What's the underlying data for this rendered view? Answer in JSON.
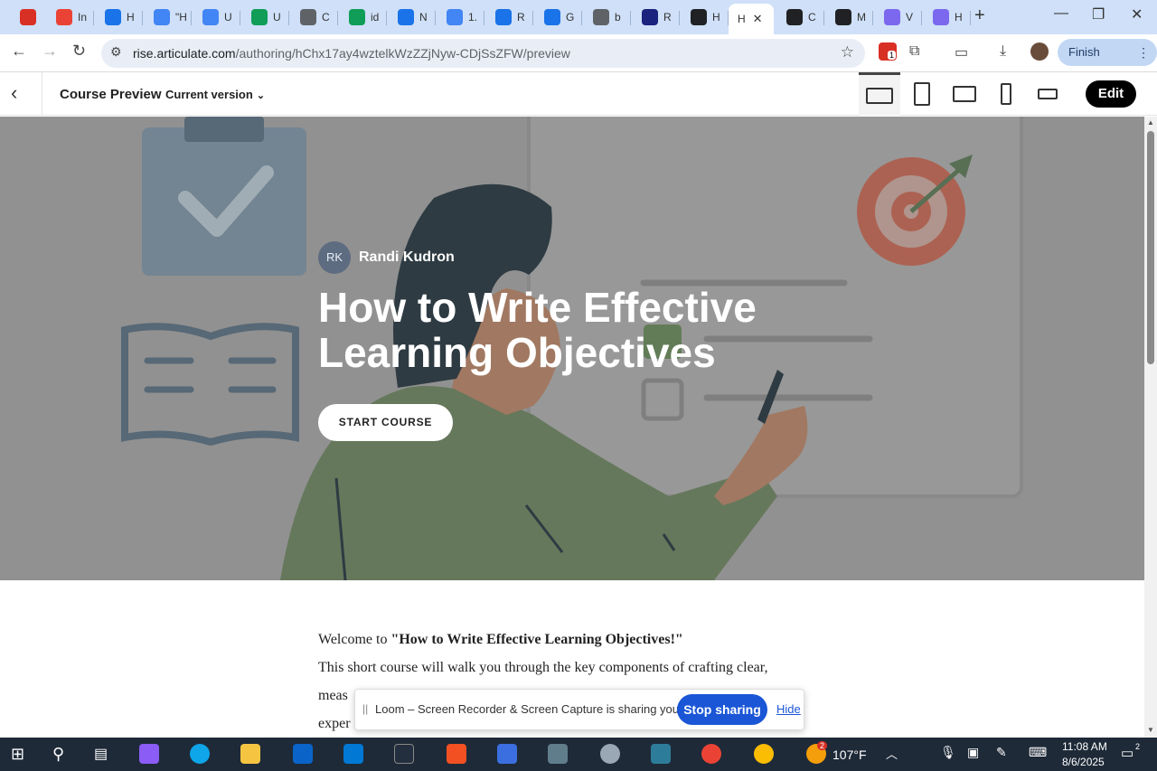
{
  "browser": {
    "tabs": [
      {
        "label": "",
        "color": "#d93025"
      },
      {
        "label": "In",
        "color": "#ea4335"
      },
      {
        "label": "H",
        "color": "#1a73e8"
      },
      {
        "label": "\"H",
        "color": "#4285f4"
      },
      {
        "label": "U",
        "color": "#4285f4"
      },
      {
        "label": "U",
        "color": "#0f9d58"
      },
      {
        "label": "C",
        "color": "#5f6368"
      },
      {
        "label": "id",
        "color": "#0f9d58"
      },
      {
        "label": "N",
        "color": "#1a73e8"
      },
      {
        "label": "1.",
        "color": "#4285f4"
      },
      {
        "label": "R",
        "color": "#1a73e8"
      },
      {
        "label": "G",
        "color": "#1a73e8"
      },
      {
        "label": "b",
        "color": "#5f6368"
      },
      {
        "label": "R",
        "color": "#1a237e"
      },
      {
        "label": "H",
        "color": "#202124"
      },
      {
        "label": "H",
        "color": "#202124"
      },
      {
        "label": "C",
        "color": "#202124"
      },
      {
        "label": "M",
        "color": "#202124"
      },
      {
        "label": "V",
        "color": "#7b68ee"
      },
      {
        "label": "H",
        "color": "#7b68ee"
      }
    ],
    "url_host": "rise.articulate.com",
    "url_path": "/authoring/hChx17ay4wztelkWzZZjNyw-CDjSsZFW/preview",
    "ext_badge": "1",
    "finish_update": "Finish update"
  },
  "header": {
    "title": "Course Preview",
    "version": "Current version",
    "edit": "Edit"
  },
  "hero": {
    "author_initials": "RK",
    "author_name": "Randi Kudron",
    "title_line1": "How to Write Effective",
    "title_line2": "Learning Objectives",
    "start_button": "START COURSE"
  },
  "content": {
    "welcome_prefix": "Welcome to ",
    "welcome_bold": "\"How to Write Effective Learning Objectives!\"",
    "line2": "This short course will walk you through the key components of crafting clear,",
    "line3": "meas",
    "line4": "exper"
  },
  "loom": {
    "message": "Loom – Screen Recorder & Screen Capture is sharing your screen.",
    "stop": "Stop sharing",
    "hide": "Hide"
  },
  "taskbar": {
    "weather_badge": "2",
    "temperature": "107°F",
    "time": "11:08 AM",
    "date": "8/6/2025",
    "notifications": "2"
  }
}
